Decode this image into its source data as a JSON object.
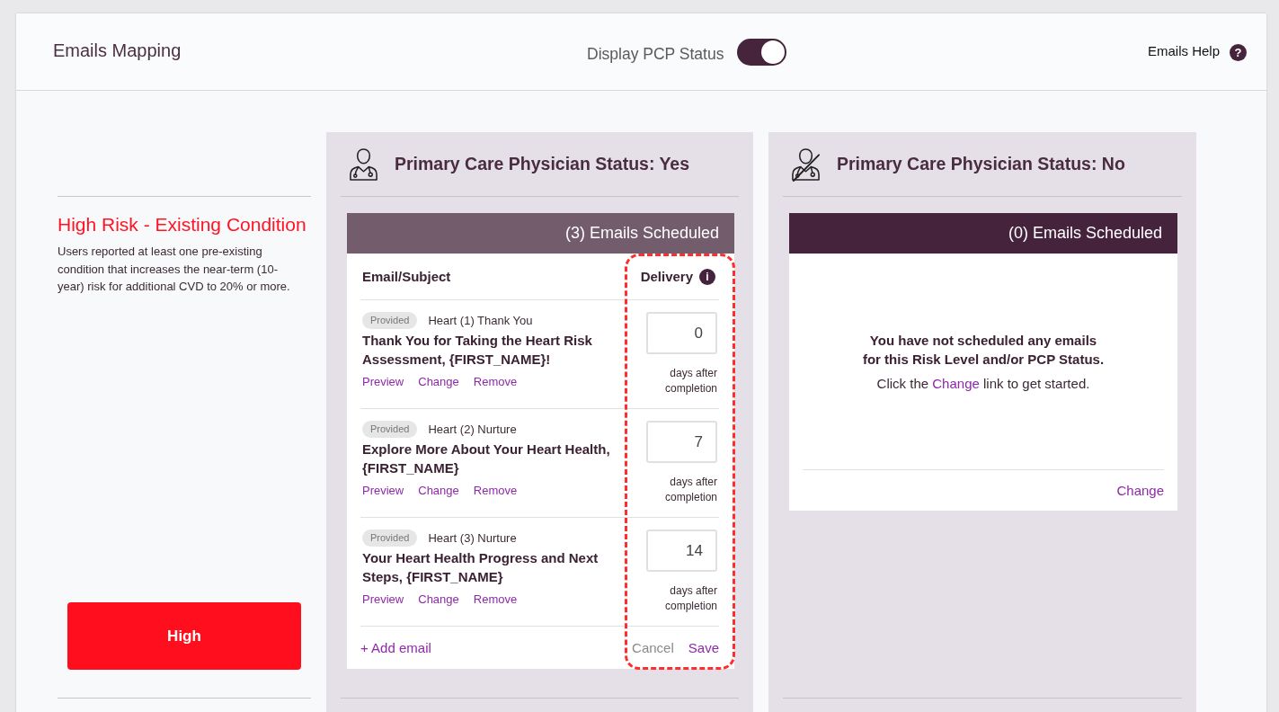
{
  "header": {
    "title": "Emails Mapping",
    "pcp_toggle": {
      "label": "Display PCP Status",
      "on": true
    },
    "help": {
      "label": "Emails Help",
      "icon": "?"
    }
  },
  "risk": {
    "title": "High Risk - Existing Condition",
    "description": "Users reported at least one pre-existing condition that increases the near-term (10-year) risk for additional CVD to 20% or more.",
    "level_button": "High"
  },
  "panels": [
    {
      "title": "Primary Care Physician Status: Yes",
      "pcp": true,
      "card": {
        "scheduled": "(3) Emails Scheduled",
        "editing": true,
        "delivery_highlighted": true,
        "columns": [
          {
            "label": "Email/Subject"
          },
          {
            "label": "Delivery",
            "info_icon": "i"
          }
        ],
        "emails": [
          {
            "badge": "Provided",
            "template": "Heart (1) Thank You",
            "subject": "Thank You for Taking the Heart Risk Assessment, {FIRST_NAME}!",
            "links": [
              "Preview",
              "Change",
              "Remove"
            ],
            "days": "0",
            "days_note": "days after completion"
          },
          {
            "badge": "Provided",
            "template": "Heart (2) Nurture",
            "subject": "Explore More About Your Heart Health, {FIRST_NAME}",
            "links": [
              "Preview",
              "Change",
              "Remove"
            ],
            "days": "7",
            "days_note": "days after completion"
          },
          {
            "badge": "Provided",
            "template": "Heart (3) Nurture",
            "subject": "Your Heart Health Progress and Next Steps, {FIRST_NAME}",
            "links": [
              "Preview",
              "Change",
              "Remove"
            ],
            "days": "14",
            "days_note": "days after completion"
          }
        ],
        "add_link": "+ Add email",
        "actions": [
          {
            "label": "Cancel",
            "kind": "cancel"
          },
          {
            "label": "Save",
            "kind": "save"
          }
        ]
      }
    },
    {
      "title": "Primary Care Physician Status: No",
      "pcp": false,
      "card": {
        "scheduled": "(0) Emails Scheduled",
        "editing": false,
        "empty_message": [
          "You have not scheduled any emails",
          "for this Risk Level and/or PCP Status."
        ],
        "empty_hint": {
          "before": "Click the",
          "link": "Change",
          "after": "link to get started."
        },
        "change_link": "Change"
      }
    }
  ]
}
